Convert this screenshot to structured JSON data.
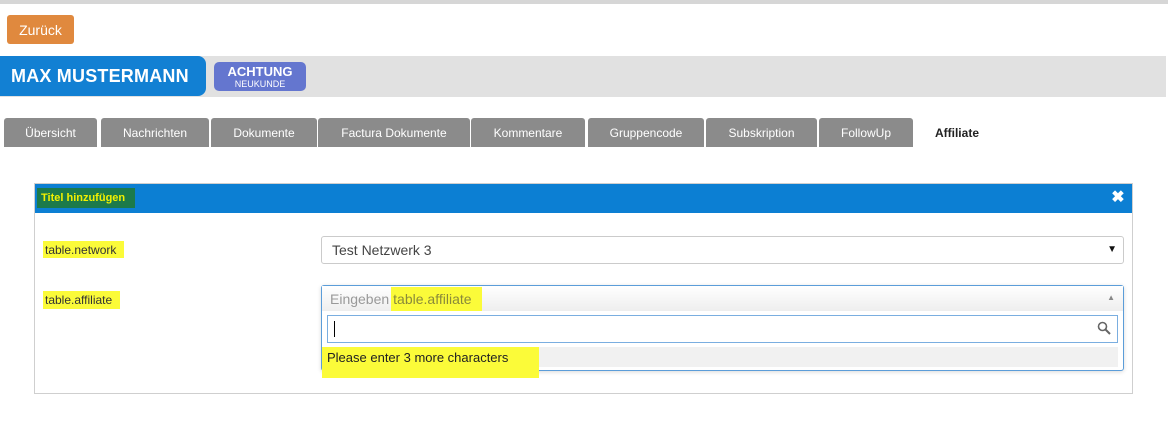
{
  "back_button": {
    "label": "Zurück"
  },
  "customer": {
    "name": "MAX MUSTERMANN",
    "badge_title": "ACHTUNG",
    "badge_subtitle": "NEUKUNDE"
  },
  "tabs": [
    {
      "label": "Übersicht"
    },
    {
      "label": "Nachrichten"
    },
    {
      "label": "Dokumente"
    },
    {
      "label": "Factura Dokumente"
    },
    {
      "label": "Kommentare"
    },
    {
      "label": "Gruppencode"
    },
    {
      "label": "Subskription"
    },
    {
      "label": "FollowUp"
    },
    {
      "label": "Affiliate",
      "active": true
    }
  ],
  "panel": {
    "title": "Titel hinzufügen",
    "close_icon": "close-icon",
    "network": {
      "label": "table.network",
      "value": "Test Netzwerk 3"
    },
    "affiliate": {
      "label": "table.affiliate",
      "placeholder_prefix": "Eingeben",
      "placeholder_key": "table.affiliate",
      "search_value": "",
      "message": "Please enter 3 more characters"
    }
  },
  "colors": {
    "back_button": "#e0893e",
    "customer_name_bg": "#1280d3",
    "badge_bg": "#6476cf",
    "tab_bg": "#8b8b8b",
    "panel_header_bg": "#0c7fd3",
    "highlight": "#fbfb39"
  }
}
